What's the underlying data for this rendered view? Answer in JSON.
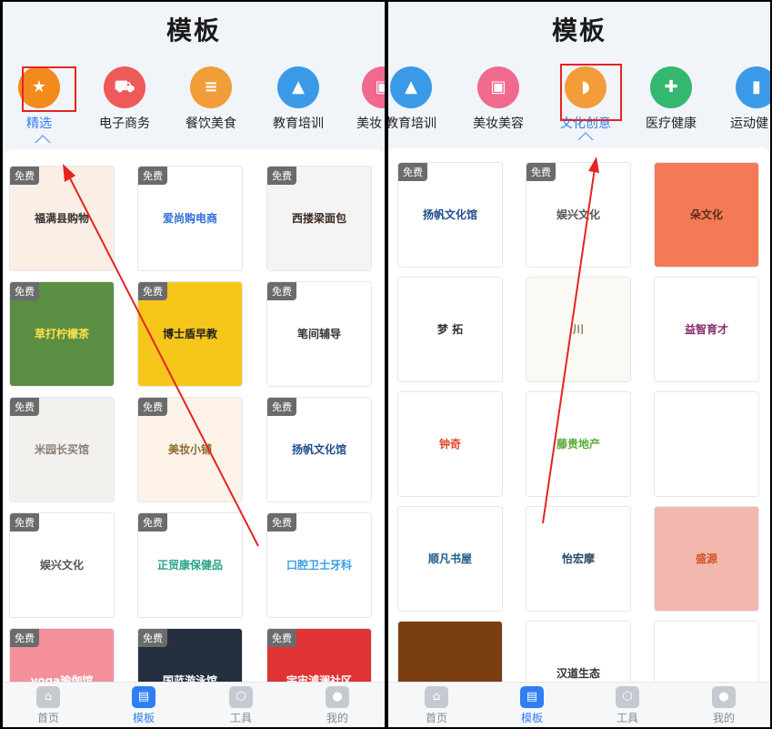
{
  "colors": {
    "accent": "#2f7ff2",
    "annotation": "#e52421"
  },
  "left": {
    "title": "模板",
    "categories": [
      {
        "label": "精选",
        "icon": "star-icon",
        "color": "#f38a1c"
      },
      {
        "label": "电子商务",
        "icon": "cart-icon",
        "color": "#ee5a5a"
      },
      {
        "label": "餐饮美食",
        "icon": "burger-icon",
        "color": "#f29c3a"
      },
      {
        "label": "教育培训",
        "icon": "graduation-cap-icon",
        "color": "#3b9ae8"
      },
      {
        "label": "美妆",
        "icon": "cosmetics-bag-icon",
        "color": "#f06a8e"
      }
    ],
    "templates": [
      {
        "free": "免费",
        "logo": "福满县购物",
        "bg": "#fbeee4",
        "fg": "#333"
      },
      {
        "free": "免费",
        "logo": "爱尚购电商",
        "bg": "#ffffff",
        "fg": "#2f6fd6"
      },
      {
        "free": "免费",
        "logo": "西搂梁面包",
        "bg": "#f4f4f4",
        "fg": "#3a2a20"
      },
      {
        "free": "免费",
        "logo": "草打柠檬茶",
        "bg": "#5a8e43",
        "fg": "#ffe14a"
      },
      {
        "free": "免费",
        "logo": "博士盾早教",
        "bg": "#f6c71a",
        "fg": "#222"
      },
      {
        "free": "免费",
        "logo": "笔间辅导",
        "bg": "#ffffff",
        "fg": "#333"
      },
      {
        "free": "免费",
        "logo": "米园长买馆",
        "bg": "#f3f1ee",
        "fg": "#8a7e72"
      },
      {
        "free": "免费",
        "logo": "美妆小铺",
        "bg": "#fdf3e8",
        "fg": "#8a6a2a"
      },
      {
        "free": "免费",
        "logo": "扬帆文化馆",
        "bg": "#ffffff",
        "fg": "#1f4d8c"
      },
      {
        "free": "免费",
        "logo": "娱兴文化",
        "bg": "#ffffff",
        "fg": "#555"
      },
      {
        "free": "免费",
        "logo": "正贸康保健品",
        "bg": "#ffffff",
        "fg": "#2aa38a"
      },
      {
        "free": "免费",
        "logo": "口腔卫士牙科",
        "bg": "#ffffff",
        "fg": "#3a9ee8"
      },
      {
        "free": "免费",
        "logo": "yoga瑜伽馆",
        "bg": "#f3909c",
        "fg": "#ffffff"
      },
      {
        "free": "免费",
        "logo": "国蓝游泳馆",
        "bg": "#243040",
        "fg": "#ffffff"
      },
      {
        "free": "免费",
        "logo": "宇宙浦澜社区",
        "bg": "#e03333",
        "fg": "#ffffff"
      }
    ],
    "tabs": [
      {
        "label": "首页",
        "icon": "home-icon",
        "glyph": "⌂"
      },
      {
        "label": "模板",
        "icon": "template-icon",
        "glyph": "▤"
      },
      {
        "label": "工具",
        "icon": "tools-icon",
        "glyph": "⬡"
      },
      {
        "label": "我的",
        "icon": "user-icon",
        "glyph": "●"
      }
    ]
  },
  "right": {
    "title": "模板",
    "categories": [
      {
        "label": "教育培训",
        "icon": "graduation-cap-icon",
        "color": "#3b9ae8"
      },
      {
        "label": "美妆美容",
        "icon": "cosmetics-bag-icon",
        "color": "#f06a8e"
      },
      {
        "label": "文化创意",
        "icon": "fan-icon",
        "color": "#f29c3a"
      },
      {
        "label": "医疗健康",
        "icon": "medical-kit-icon",
        "color": "#34b76e"
      },
      {
        "label": "运动健",
        "icon": "fitness-icon",
        "color": "#3b9ae8"
      }
    ],
    "templates": [
      {
        "free": "免费",
        "logo": "扬帆文化馆",
        "bg": "#ffffff",
        "fg": "#1f4d8c"
      },
      {
        "free": "免费",
        "logo": "娱兴文化",
        "bg": "#ffffff",
        "fg": "#555"
      },
      {
        "free": "",
        "logo": "朵文化",
        "bg": "#f47a55",
        "fg": "#5a2a1a"
      },
      {
        "free": "",
        "logo": "梦 拓",
        "bg": "#ffffff",
        "fg": "#333"
      },
      {
        "free": "",
        "logo": "川",
        "bg": "#fbf9f4",
        "fg": "#8a7a5a"
      },
      {
        "free": "",
        "logo": "益智育才",
        "bg": "#ffffff",
        "fg": "#8a2a6a"
      },
      {
        "free": "",
        "logo": "钟奇",
        "bg": "#ffffff",
        "fg": "#e04a2a"
      },
      {
        "free": "",
        "logo": "藤贵地产",
        "bg": "#ffffff",
        "fg": "#5aaa3a"
      },
      {
        "free": "",
        "logo": "",
        "bg": "#ffffff",
        "fg": "#333"
      },
      {
        "free": "",
        "logo": "顺凡书屋",
        "bg": "#ffffff",
        "fg": "#1f5a8a"
      },
      {
        "free": "",
        "logo": "怡宏摩",
        "bg": "#ffffff",
        "fg": "#2a4a6a"
      },
      {
        "free": "",
        "logo": "盛源",
        "bg": "#f2b8ad",
        "fg": "#d8532a"
      },
      {
        "free": "",
        "logo": "",
        "bg": "#7a3e12",
        "fg": "#f7a53a"
      },
      {
        "free": "",
        "logo": "汉道生态",
        "bg": "#ffffff",
        "fg": "#333"
      },
      {
        "free": "",
        "logo": "",
        "bg": "#ffffff",
        "fg": "#333"
      }
    ],
    "tabs": [
      {
        "label": "首页",
        "icon": "home-icon",
        "glyph": "⌂"
      },
      {
        "label": "模板",
        "icon": "template-icon",
        "glyph": "▤"
      },
      {
        "label": "工具",
        "icon": "tools-icon",
        "glyph": "⬡"
      },
      {
        "label": "我的",
        "icon": "user-icon",
        "glyph": "●"
      }
    ]
  }
}
